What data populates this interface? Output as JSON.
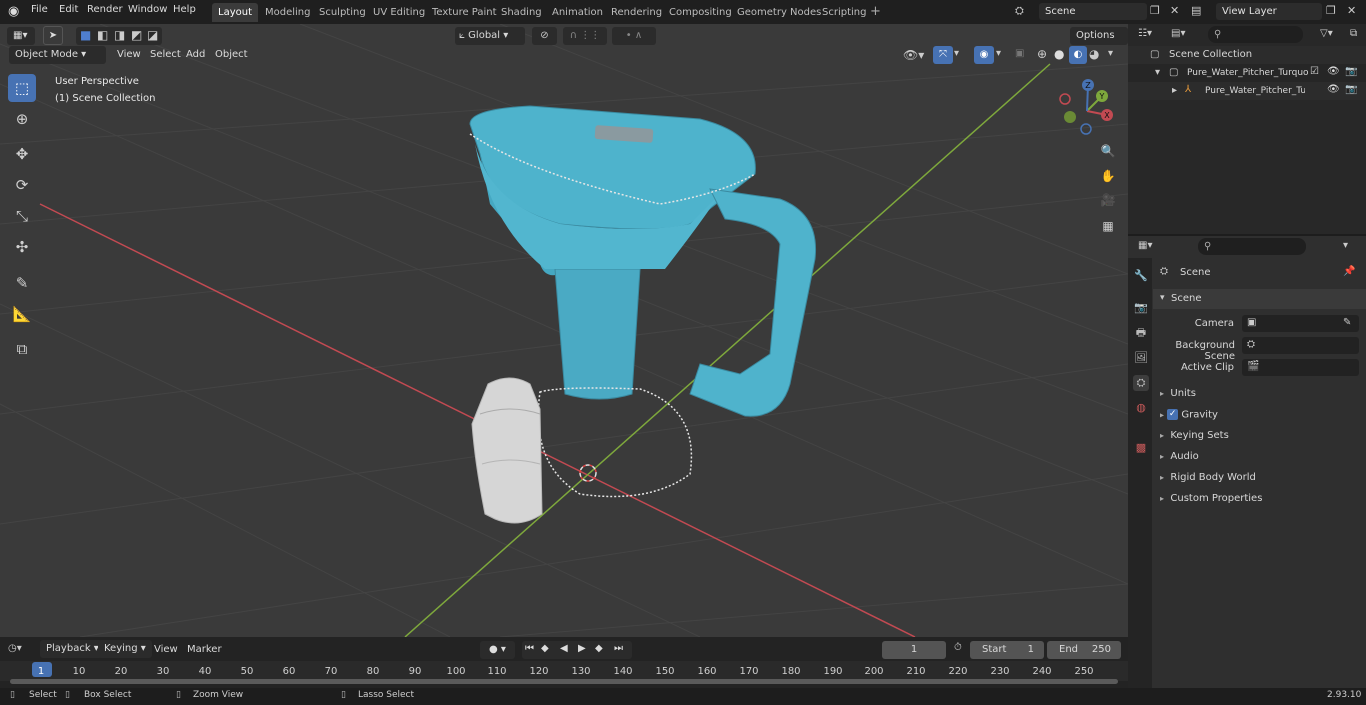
{
  "menu": [
    "File",
    "Edit",
    "Render",
    "Window",
    "Help"
  ],
  "workspaces": [
    "Layout",
    "Modeling",
    "Sculpting",
    "UV Editing",
    "Texture Paint",
    "Shading",
    "Animation",
    "Rendering",
    "Compositing",
    "Geometry Nodes",
    "Scripting"
  ],
  "active_workspace": "Layout",
  "scene_name": "Scene",
  "view_layer": "View Layer",
  "viewport": {
    "mode": "Object Mode",
    "header_menus": [
      "View",
      "Select",
      "Add",
      "Object"
    ],
    "transform_orientation": "Global",
    "options_label": "Options",
    "overlay_line1": "User Perspective",
    "overlay_line2": "(1) Scene Collection",
    "gizmo_axes": [
      "Y",
      "X",
      "Z"
    ]
  },
  "outliner": {
    "root": "Scene Collection",
    "items": [
      {
        "label": "Pure_Water_Pitcher_Turquoise"
      },
      {
        "label": "Pure_Water_Pitcher_Turq"
      }
    ]
  },
  "properties": {
    "context": "Scene",
    "section": "Scene",
    "fields": [
      {
        "label": "Camera"
      },
      {
        "label": "Background Scene"
      },
      {
        "label": "Active Clip"
      }
    ],
    "panels": [
      "Units",
      "Gravity",
      "Keying Sets",
      "Audio",
      "Rigid Body World",
      "Custom Properties"
    ]
  },
  "timeline": {
    "menus": [
      "Playback",
      "Keying",
      "View",
      "Marker"
    ],
    "current_frame": "1",
    "start_label": "Start",
    "start": "1",
    "end_label": "End",
    "end": "250",
    "ruler": [
      "1",
      "10",
      "20",
      "30",
      "40",
      "50",
      "60",
      "70",
      "80",
      "90",
      "100",
      "110",
      "120",
      "130",
      "140",
      "150",
      "160",
      "170",
      "180",
      "190",
      "200",
      "210",
      "220",
      "230",
      "240",
      "250"
    ]
  },
  "status": {
    "select": "Select",
    "box_select": "Box Select",
    "zoom_view": "Zoom View",
    "lasso_select": "Lasso Select",
    "version": "2.93.10"
  },
  "colors": {
    "accent": "#4772b3",
    "pitcher": "#4fb3cc",
    "x_axis": "#c24a52",
    "y_axis": "#7ea83c"
  }
}
